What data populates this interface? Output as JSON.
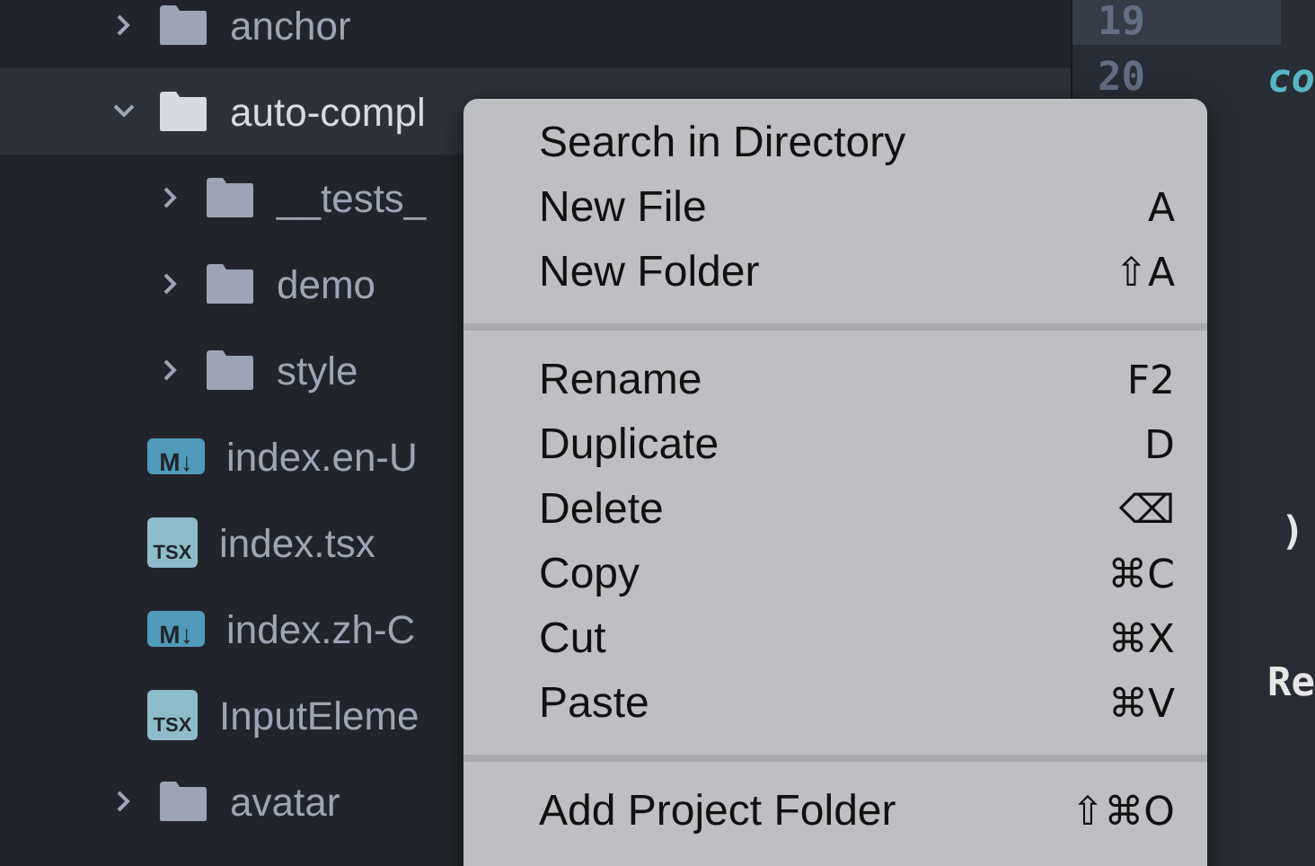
{
  "tree": [
    {
      "kind": "folder",
      "label": "anchor",
      "expanded": false,
      "selected": false
    },
    {
      "kind": "folder",
      "label": "auto-compl",
      "expanded": true,
      "selected": true,
      "children": [
        {
          "kind": "folder",
          "label": "__tests_",
          "expanded": false,
          "selected": false
        },
        {
          "kind": "folder",
          "label": "demo",
          "expanded": false,
          "selected": false
        },
        {
          "kind": "folder",
          "label": "style",
          "expanded": false,
          "selected": false
        },
        {
          "kind": "markdown",
          "label": "index.en-U",
          "badge": "M↓",
          "selected": false
        },
        {
          "kind": "tsx",
          "label": "index.tsx",
          "badge": "TSX",
          "selected": false
        },
        {
          "kind": "markdown",
          "label": "index.zh-C",
          "badge": "M↓",
          "selected": false
        },
        {
          "kind": "tsx",
          "label": "InputEleme",
          "badge": "TSX",
          "selected": false
        }
      ]
    },
    {
      "kind": "folder",
      "label": "avatar",
      "expanded": false,
      "selected": false
    }
  ],
  "editor": {
    "lines": [
      {
        "number": "19",
        "current": true
      },
      {
        "number": "20",
        "text": "co",
        "kind": "keyword"
      },
      {
        "text": ")",
        "kind": "plain"
      },
      {
        "text": "Re",
        "kind": "plain"
      }
    ]
  },
  "context_menu": {
    "sections": [
      [
        {
          "label": "Search in Directory"
        },
        {
          "label": "New File",
          "shortcut": "A"
        },
        {
          "label": "New Folder",
          "shortcut": "⇧A"
        }
      ],
      [
        {
          "label": "Rename",
          "shortcut": "F2"
        },
        {
          "label": "Duplicate",
          "shortcut": "D"
        },
        {
          "label": "Delete",
          "shortcut": "⌫"
        },
        {
          "label": "Copy",
          "shortcut": "⌘C"
        },
        {
          "label": "Cut",
          "shortcut": "⌘X"
        },
        {
          "label": "Paste",
          "shortcut": "⌘V"
        }
      ],
      [
        {
          "label": "Add Project Folder",
          "shortcut": "⇧⌘O"
        }
      ]
    ]
  }
}
